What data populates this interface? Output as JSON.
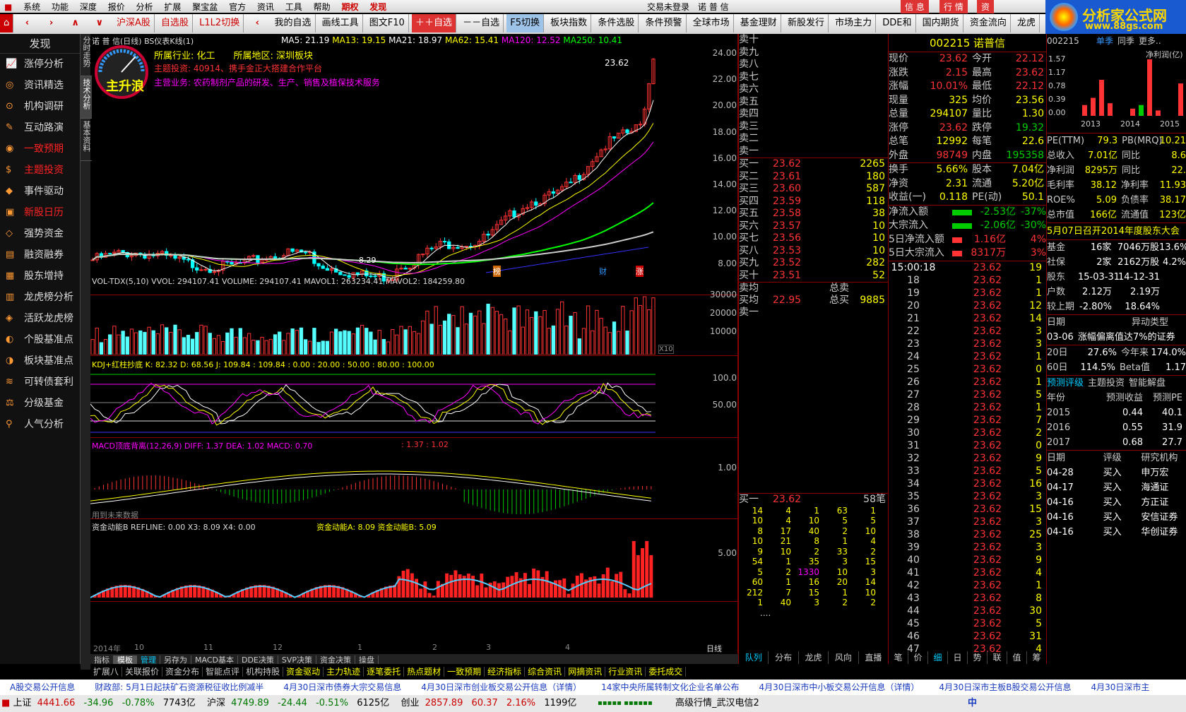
{
  "menu": [
    "系统",
    "功能",
    "深度",
    "报价",
    "分析",
    "扩展",
    "聚宝盆",
    "官方",
    "资讯",
    "工具",
    "帮助",
    "期权",
    "发现"
  ],
  "title_center": "交易未登录　诺 普 信",
  "menu_right": [
    "信 息",
    "行 情",
    "资"
  ],
  "toolbar": [
    "沪深A股",
    "自选股",
    "L1L2切换",
    "我的自选",
    "画线工具",
    "图文F10",
    "＋＋自选",
    "－－自选",
    "F5切换",
    "板块指数",
    "条件选股",
    "条件预警",
    "全球市场",
    "基金理财",
    "新股发行",
    "市场主力",
    "DDE和",
    "国内期货",
    "资金流向",
    "龙虎"
  ],
  "logo": {
    "text": "分析家公式网",
    "url_text": "www.88gs.com"
  },
  "sidebar": {
    "head": "发现",
    "items": [
      "涨停分析",
      "资讯精选",
      "机构调研",
      "互动路演",
      "一致预期",
      "主题投资",
      "事件驱动",
      "新股日历",
      "强势资金",
      "融资融券",
      "股东增持",
      "龙虎榜分析",
      "活跃龙虎榜",
      "个股基准点",
      "板块基准点",
      "可转债套利",
      "分级基金",
      "人气分析"
    ]
  },
  "vtabs": [
    "分时走势",
    "技术分析",
    "基本资料"
  ],
  "main": {
    "header": "诺 普 信(日线) BS仪表K线(1)",
    "ma": [
      "MA5: 21.19",
      "MA13: 19.15",
      "MA21: 18.97",
      "MA62: 15.41",
      "MA120: 12.52",
      "MA250: 10.41"
    ],
    "info1": "所属行业: 化工　　所属地区: 深圳板块",
    "info2": "主题投资: 40914、携手金正大搭建合作平台",
    "info3": "主营业务: 农药制剂产品的研发、生产、销售及植保技术服务",
    "gauge": "主升浪",
    "price_hi": "23.62",
    "price_lo": "8.29",
    "yax": [
      "24.00",
      "22.00",
      "20.00",
      "18.00",
      "16.00",
      "14.00",
      "12.00",
      "10.00",
      "8.00"
    ],
    "marks": [
      "榜",
      "财",
      "涨"
    ],
    "vol_label": "VOL-TDX(5,10) VVOL: 294107.41  VOLUME: 294107.41  MAVOL1: 263234.41  MAVOL2: 184259.80",
    "vol_yax": [
      "30000",
      "20000",
      "10000"
    ],
    "vol_unit": "X10",
    "kdj_label": "KDJ+红柱抄底  K: 82.32  D: 68.56  J: 109.84 : 109.84   : 0.00  : 20.00  : 50.00  : 80.00  : 100.00",
    "kdj_yax": [
      "100.0",
      "50.00"
    ],
    "macd_label": "MACD顶底背离(12,26,9)  DIFF: 1.37  DEA: 1.02  MACD: 0.70",
    "macd_extra": ": 1.37  : 1.02",
    "macd_yax": "1.00",
    "macd_note": "用到未来数据",
    "zj_label": "资金动能B  REFLINE: 0.00  X3: 8.09  X4: 0.00",
    "zj_extra": "资金动能A: 8.09  资金动能B: 5.09",
    "zj_yax": "5.00",
    "dates": [
      "2014年",
      "10",
      "11",
      "12",
      "1",
      "2",
      "3",
      "4"
    ],
    "period": "日线"
  },
  "bottomtabs": [
    "指标",
    "模板",
    "管理",
    "另存为",
    "MACD基本",
    "DDE决策",
    "SVP决策",
    "资金决策",
    "操盘"
  ],
  "bottomtabs2": [
    "扩展八",
    "关联报价",
    "资金分布",
    "智能点评",
    "机构持股",
    "资金驱动",
    "主力轨迹",
    "逐笔委托",
    "热点题材",
    "一致预期",
    "经济指标",
    "综合资讯",
    "网摘资讯",
    "行业资讯",
    "委托成交"
  ],
  "orderbook": {
    "sells": [
      "卖十",
      "卖九",
      "卖八",
      "卖七",
      "卖六",
      "卖五",
      "卖四",
      "卖三",
      "卖二",
      "卖一"
    ],
    "buys": [
      [
        "买一",
        "23.62",
        "2265"
      ],
      [
        "买二",
        "23.61",
        "180"
      ],
      [
        "买三",
        "23.60",
        "587"
      ],
      [
        "买四",
        "23.59",
        "118"
      ],
      [
        "买五",
        "23.58",
        "38"
      ],
      [
        "买六",
        "23.57",
        "10"
      ],
      [
        "买七",
        "23.56",
        "10"
      ],
      [
        "买八",
        "23.53",
        "10"
      ],
      [
        "买九",
        "23.52",
        "282"
      ],
      [
        "买十",
        "23.51",
        "52"
      ]
    ],
    "junmai": [
      "卖均",
      "",
      "总卖"
    ],
    "junbuy": [
      "买均",
      "22.95",
      "总买",
      "9885"
    ],
    "buy1": [
      "买一",
      "23.62",
      "58笔"
    ],
    "grid": [
      [
        "14",
        "4",
        "1",
        "63",
        "1"
      ],
      [
        "10",
        "4",
        "10",
        "5",
        "5"
      ],
      [
        "8",
        "17",
        "40",
        "2",
        "10"
      ],
      [
        "10",
        "21",
        "8",
        "1",
        "4"
      ],
      [
        "9",
        "10",
        "2",
        "33",
        "2"
      ],
      [
        "54",
        "1",
        "35",
        "3",
        "15"
      ],
      [
        "5",
        "2",
        "1330",
        "10",
        "3"
      ],
      [
        "60",
        "1",
        "16",
        "20",
        "14"
      ],
      [
        "212",
        "7",
        "15",
        "1",
        "10"
      ],
      [
        "1",
        "40",
        "3",
        "2",
        "2"
      ]
    ],
    "tabs": [
      "队列",
      "分布",
      "龙虎",
      "风向",
      "直播"
    ]
  },
  "quote": {
    "title": "002215 诺普信",
    "rows": [
      [
        "现价",
        "23.62",
        "今开",
        "22.12"
      ],
      [
        "涨跌",
        "2.15",
        "最高",
        "23.62"
      ],
      [
        "涨幅",
        "10.01%",
        "最低",
        "22.12"
      ],
      [
        "现量",
        "325",
        "均价",
        "23.56"
      ],
      [
        "总量",
        "294107",
        "量比",
        "1.30"
      ],
      [
        "涨停",
        "23.62",
        "跌停",
        "19.32"
      ],
      [
        "总笔",
        "12992",
        "每笔",
        "22.6"
      ],
      [
        "外盘",
        "98749",
        "内盘",
        "195358"
      ]
    ],
    "rows2": [
      [
        "换手",
        "5.66%",
        "股本",
        "7.04亿"
      ],
      [
        "净资",
        "2.31",
        "流通",
        "5.20亿"
      ],
      [
        "收益(一)",
        "0.118",
        "PE(动)",
        "50.1"
      ]
    ],
    "flows": [
      [
        "净流入额",
        "-2.53亿",
        "-37%"
      ],
      [
        "大宗流入",
        "-2.06亿",
        "-30%"
      ],
      [
        "5日净流入额",
        "1.16亿",
        "4%"
      ],
      [
        "5日大宗流入",
        "8317万",
        "3%"
      ]
    ],
    "ticks_head": [
      "15:00:18",
      "23.62",
      "19"
    ],
    "ticks": [
      [
        "18",
        "23.62",
        "1"
      ],
      [
        "19",
        "23.62",
        "1"
      ],
      [
        "20",
        "23.62",
        "12"
      ],
      [
        "21",
        "23.62",
        "14"
      ],
      [
        "22",
        "23.62",
        "3"
      ],
      [
        "23",
        "23.62",
        "3"
      ],
      [
        "24",
        "23.62",
        "1"
      ],
      [
        "25",
        "23.62",
        "0"
      ],
      [
        "26",
        "23.62",
        "1"
      ],
      [
        "27",
        "23.62",
        "5"
      ],
      [
        "28",
        "23.62",
        "1"
      ],
      [
        "29",
        "23.62",
        "7"
      ],
      [
        "30",
        "23.62",
        "2"
      ],
      [
        "31",
        "23.62",
        "0"
      ],
      [
        "32",
        "23.62",
        "9"
      ],
      [
        "33",
        "23.62",
        "5"
      ],
      [
        "34",
        "23.62",
        "16"
      ],
      [
        "35",
        "23.62",
        "3"
      ],
      [
        "36",
        "23.62",
        "15"
      ],
      [
        "37",
        "23.62",
        "3"
      ],
      [
        "38",
        "23.62",
        "25"
      ],
      [
        "39",
        "23.62",
        "3"
      ],
      [
        "40",
        "23.62",
        "9"
      ],
      [
        "41",
        "23.62",
        "4"
      ],
      [
        "42",
        "23.62",
        "1"
      ],
      [
        "43",
        "23.62",
        "8"
      ],
      [
        "44",
        "23.62",
        "30"
      ],
      [
        "45",
        "23.62",
        "5"
      ],
      [
        "46",
        "23.62",
        "31"
      ],
      [
        "47",
        "23.62",
        "4"
      ]
    ],
    "tabs": [
      "笔",
      "价",
      "细",
      "日",
      "势",
      "联",
      "值",
      "筹"
    ]
  },
  "f10": {
    "code": "002215",
    "links": [
      "单季",
      "同季",
      "更多.."
    ],
    "chart_title": "净利润(亿)",
    "chart_y": [
      "1.57",
      "1.17",
      "0.78",
      "0.39",
      "0.00"
    ],
    "chart_x": [
      "2013",
      "2014",
      "2015"
    ],
    "rows": [
      [
        "PE(TTM)",
        "79.3",
        "PB(MRQ)",
        "10.21"
      ],
      [
        "总收入",
        "7.01亿",
        "同比",
        "8.6"
      ],
      [
        "净利润",
        "8295万",
        "同比",
        "22."
      ],
      [
        "毛利率",
        "38.12",
        "净利率",
        "11.93"
      ],
      [
        "ROE%",
        "5.09",
        "负债率",
        "38.17"
      ],
      [
        "总市值",
        "166亿",
        "流通值",
        "123亿"
      ]
    ],
    "notice": "5月07日召开2014年度股东大会",
    "hold": [
      [
        "基金",
        "16家",
        "7046万股",
        "13.6%"
      ],
      [
        "社保",
        "2家",
        "2162万股",
        "4.2%"
      ],
      [
        "股东",
        "15-03-31",
        "14-12-31",
        ""
      ],
      [
        "户数",
        "2.12万",
        "2.19万",
        ""
      ],
      [
        "较上期",
        "-2.80%",
        "18.64%",
        ""
      ]
    ],
    "event_head": [
      "日期",
      "异动类型"
    ],
    "event": [
      "03-06",
      "涨幅偏离值达7%的证券"
    ],
    "perf": [
      [
        "20日",
        "27.6%",
        "今年来",
        "174.0%"
      ],
      [
        "60日",
        "114.5%",
        "Beta值",
        "1.17"
      ]
    ],
    "tabs": [
      "预测评级",
      "主题投资",
      "智能解盘"
    ],
    "fc_head": [
      "年份",
      "预测收益",
      "预测PE"
    ],
    "fc": [
      [
        "2015",
        "0.44",
        "40.1"
      ],
      [
        "2016",
        "0.55",
        "31.9"
      ],
      [
        "2017",
        "0.68",
        "27.7"
      ]
    ],
    "rt_head": [
      "日期",
      "评级",
      "研究机构"
    ],
    "rt": [
      [
        "04-28",
        "买入",
        "申万宏"
      ],
      [
        "04-17",
        "买入",
        "海通证"
      ],
      [
        "04-16",
        "买入",
        "方正证"
      ],
      [
        "04-16",
        "买入",
        "安信证券"
      ],
      [
        "04-16",
        "买入",
        "华创证券"
      ]
    ]
  },
  "news": [
    "A股交易公开信息",
    "财政部: 5月1日起扶矿石资源税征收比例减半",
    "4月30日深市债券大宗交易信息",
    "4月30日深市创业板交易公开信息（详情）",
    "14家中央所属转制文化企业名单公布",
    "4月30日深市中小板交易公开信息（详情）",
    "4月30日深市主板B股交易公开信息",
    "4月30日深市主"
  ],
  "status": {
    "sh": [
      "上证",
      "4441.66",
      "-34.96",
      "-0.78%",
      "7743亿"
    ],
    "hs": [
      "沪深",
      "4749.89",
      "-24.44",
      "-0.51%",
      "6125亿"
    ],
    "cy": [
      "创业",
      "2857.89",
      "60.37",
      "2.16%",
      "1199亿"
    ],
    "feed": "高级行情_武汉电信2",
    "ime": "中"
  },
  "colors": {
    "up": "#ff3333",
    "down": "#00ffff",
    "ma5": "#ffffff",
    "ma13": "#ffff00",
    "ma21": "#ff00ff",
    "ma62": "#00ff00",
    "ma120": "#cccccc",
    "ma250": "#3333ff"
  }
}
